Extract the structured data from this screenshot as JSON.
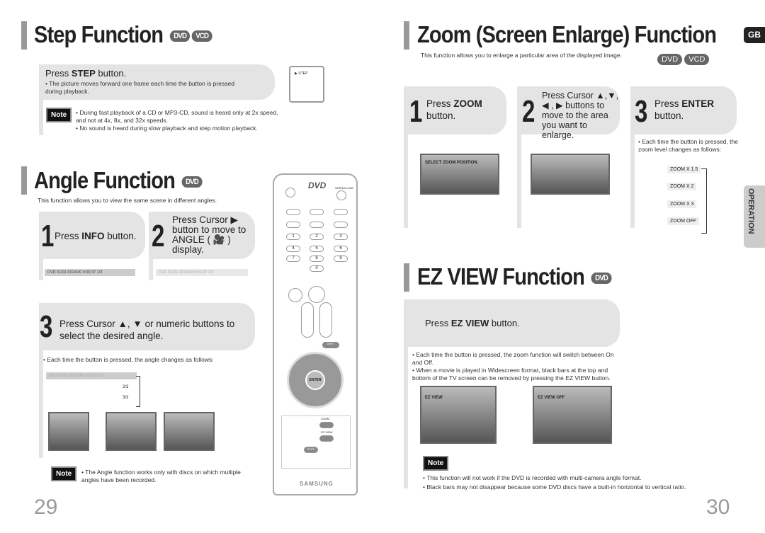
{
  "left": {
    "step": {
      "title": "Step Function",
      "badges": [
        "DVD",
        "VCD"
      ],
      "instruction_pre": "Press ",
      "instruction_bold": "STEP",
      "instruction_post": " button.",
      "bullet": "• The picture moves forward one frame each time the button is pressed during playback.",
      "screen_label": "▶ STEP",
      "note_label": "Note",
      "notes": [
        "• During fast playback of a CD or MP3-CD, sound is heard only at 2x speed, and not at 4x, 8x, and 32x speeds.",
        "• No sound is heard during slow playback and step motion playback."
      ]
    },
    "angle": {
      "title": "Angle Function",
      "badges": [
        "DVD"
      ],
      "subtitle": "This function allows you to view the same scene in different angles.",
      "step1": {
        "num": "1",
        "pre": "Press ",
        "bold": "INFO",
        "post": " button."
      },
      "step2": {
        "num": "2",
        "text": "Press Cursor ▶ button to move to ANGLE ( 🎥 ) display."
      },
      "step3": {
        "num": "3",
        "text": "Press Cursor ▲, ▼ or numeric buttons to select the desired angle."
      },
      "infobar": "DVD  01/01   001/040   0:00:37   1/3",
      "angles": [
        "1/3",
        "2/3",
        "3/3"
      ],
      "bullet": "• Each time the button is pressed, the angle changes as follows:",
      "note_label": "Note",
      "note": "• The Angle function works only with discs on which multiple angles have been recorded."
    },
    "page_number": "29"
  },
  "remote": {
    "brand": "SAMSUNG",
    "logo": "DVD",
    "open_close": "OPEN/CLOSE",
    "enter": "ENTER",
    "zoom": "ZOOM",
    "ez_view": "EZ VIEW",
    "step": "STEP",
    "info": "INFO",
    "numbers": [
      "1",
      "2",
      "3",
      "4",
      "5",
      "6",
      "7",
      "8",
      "9",
      "0"
    ]
  },
  "right": {
    "zoom": {
      "title": "Zoom (Screen Enlarge) Function",
      "badges": [
        "DVD",
        "VCD"
      ],
      "subtitle": "This function allows you to enlarge a particular area of the displayed image.",
      "step1": {
        "num": "1",
        "pre": "Press ",
        "bold": "ZOOM",
        "post": " button."
      },
      "step2": {
        "num": "2",
        "text": "Press Cursor ▲,▼, ◀ , ▶ buttons to move to the area you want to enlarge."
      },
      "step3": {
        "num": "3",
        "pre": "Press ",
        "bold": "ENTER",
        "post": " button."
      },
      "bullet": "• Each time the button is pressed, the zoom level changes as follows:",
      "screen_label": "SELECT ZOOM POSITION",
      "levels": [
        "ZOOM X 1.5",
        "ZOOM X 2",
        "ZOOM X 3",
        "ZOOM OFF"
      ]
    },
    "gb": "GB",
    "section_tab": "OPERATION",
    "ezview": {
      "title": "EZ VIEW Function",
      "badges": [
        "DVD"
      ],
      "instruction_pre": "Press ",
      "instruction_bold": "EZ VIEW",
      "instruction_post": " button.",
      "bullets": [
        "• Each time the button is pressed, the zoom function will switch between On and Off.",
        "• When a movie is played in Widescreen format, black bars at the top and bottom of the TV screen can be removed by pressing the EZ VIEW button."
      ],
      "screen_on": "EZ VIEW",
      "screen_off": "EZ VIEW OFF",
      "note_label": "Note",
      "notes": [
        "• This function will not work if the DVD is recorded with multi-camera angle format.",
        "• Black bars may not disappear because some DVD discs have a built-in horizontal to vertical ratio."
      ]
    },
    "page_number": "30"
  }
}
